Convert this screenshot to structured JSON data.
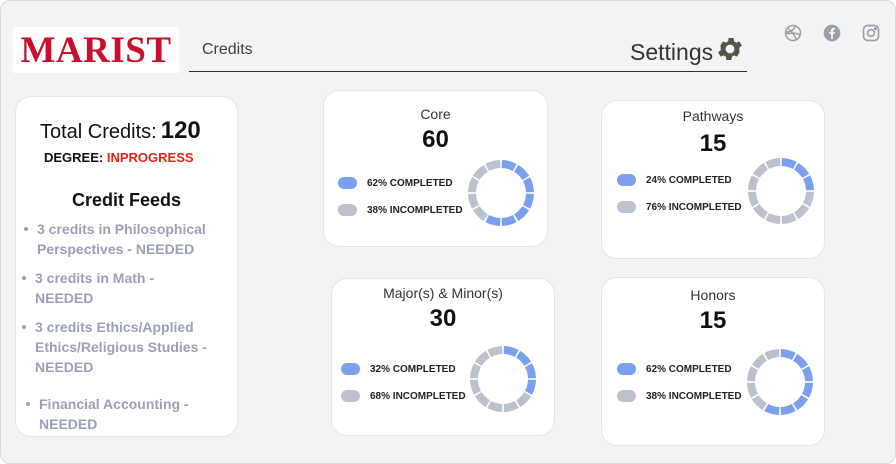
{
  "header": {
    "logo_text": "MARIST",
    "nav_title": "Credits",
    "settings_label": "Settings",
    "social_icons": [
      "dribbble-icon",
      "facebook-icon",
      "instagram-icon"
    ]
  },
  "summary": {
    "total_label": "Total Credits:",
    "total_value": "120",
    "degree_label": "DEGREE:",
    "degree_status": "INPROGRESS",
    "feeds_title": "Credit Feeds",
    "feeds": [
      "3 credits in Philosophical Perspectives - NEEDED",
      "3 credits in Math - NEEDED",
      "3 credits Ethics/Applied Ethics/Religious Studies - NEEDED",
      "Financial Accounting - NEEDED"
    ]
  },
  "categories": [
    {
      "id": "core",
      "title": "Core",
      "credits": "60",
      "completed_pct": 62,
      "completed_label": "62% COMPLETED",
      "incompleted_label": "38% INCOMPLETED"
    },
    {
      "id": "pathways",
      "title": "Pathways",
      "credits": "15",
      "completed_pct": 24,
      "completed_label": "24% COMPLETED",
      "incompleted_label": "76% INCOMPLETED"
    },
    {
      "id": "majors",
      "title": "Major(s) & Minor(s)",
      "credits": "30",
      "completed_pct": 32,
      "completed_label": "32% COMPLETED",
      "incompleted_label": "68% INCOMPLETED"
    },
    {
      "id": "honors",
      "title": "Honors",
      "credits": "15",
      "completed_pct": 62,
      "completed_label": "62% COMPLETED",
      "incompleted_label": "38% INCOMPLETED"
    }
  ],
  "colors": {
    "completed": "#7aa0ef",
    "incompleted": "#bcc1cf",
    "brand": "#c8102e",
    "status": "#e0251b"
  }
}
